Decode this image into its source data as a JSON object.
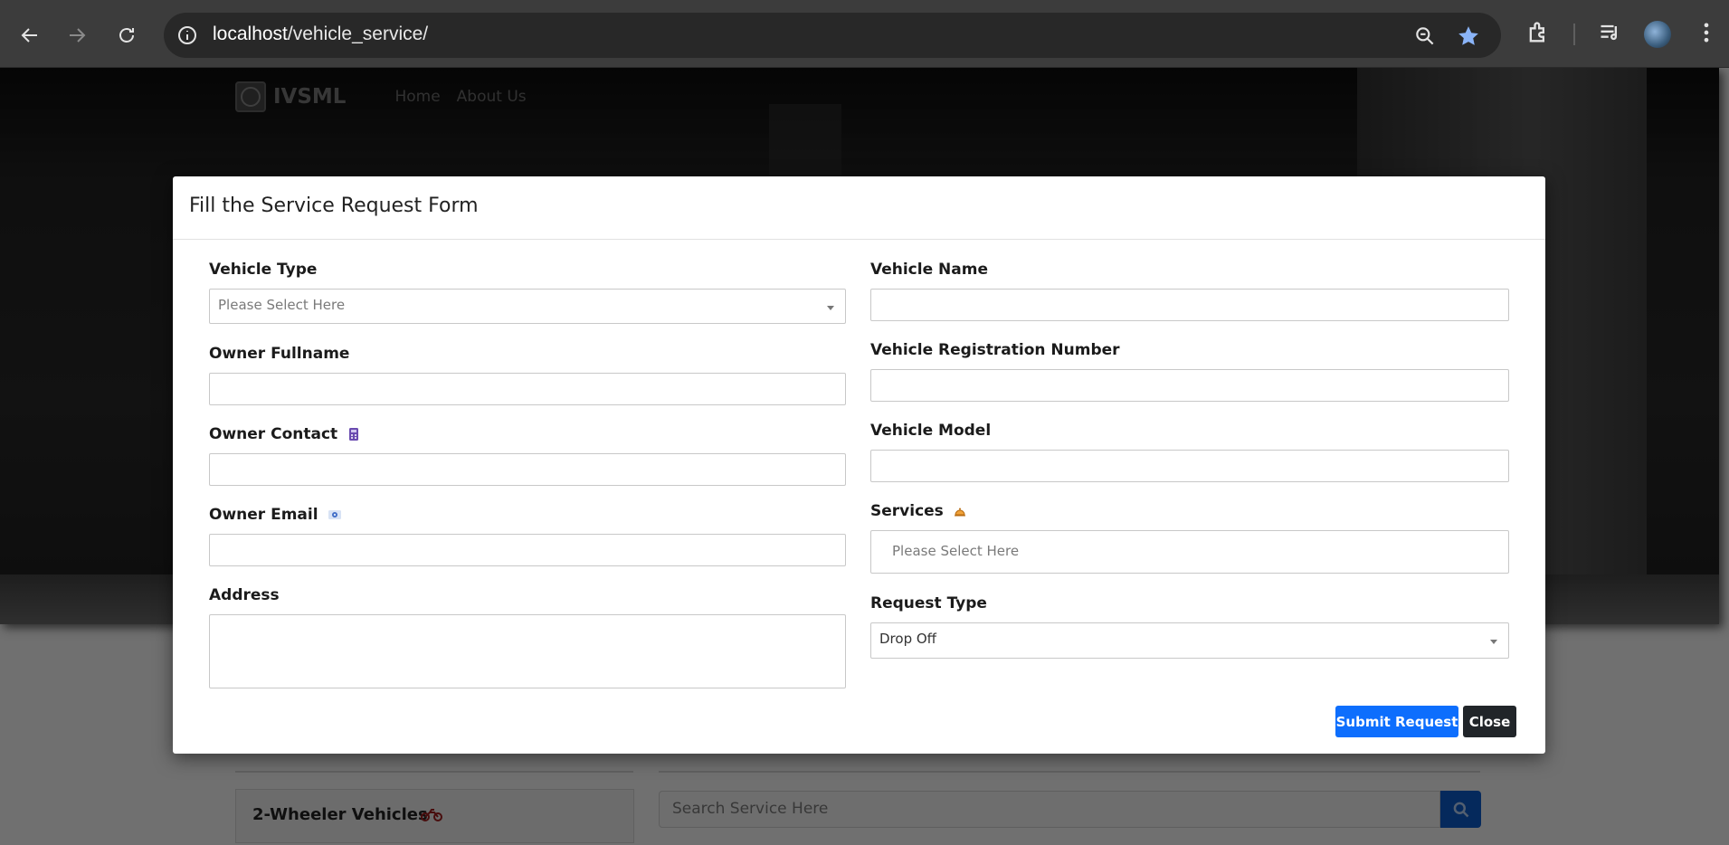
{
  "browser": {
    "url_host": "localhost",
    "url_path": "/vehicle_service/"
  },
  "site": {
    "brand": "IVSML",
    "nav": [
      "Home",
      "About Us"
    ]
  },
  "modal": {
    "title": "Fill the Service Request Form",
    "left": {
      "vehicle_type_label": "Vehicle Type",
      "vehicle_type_value": "Please Select Here",
      "owner_fullname_label": "Owner Fullname",
      "owner_contact_label": "Owner Contact",
      "owner_email_label": "Owner Email",
      "address_label": "Address"
    },
    "right": {
      "vehicle_name_label": "Vehicle Name",
      "vehicle_reg_label": "Vehicle Registration Number",
      "vehicle_model_label": "Vehicle Model",
      "services_label": "Services",
      "services_value": "Please Select Here",
      "request_type_label": "Request Type",
      "request_type_value": "Drop Off"
    },
    "submit_label": "Submit Request",
    "close_label": "Close"
  },
  "page": {
    "category_label": "2-Wheeler Vehicles",
    "search_placeholder": "Search Service Here"
  }
}
